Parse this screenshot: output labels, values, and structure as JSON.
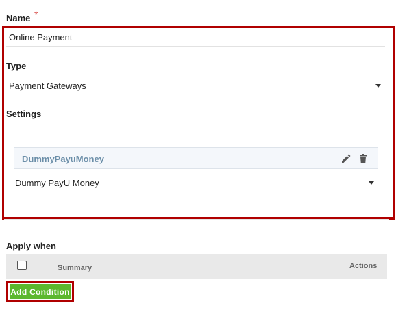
{
  "form": {
    "name_label": "Name",
    "required_mark": "*",
    "name_value": "Online Payment",
    "type_label": "Type",
    "type_value": "Payment Gateways",
    "settings_label": "Settings"
  },
  "gateway": {
    "title": "DummyPayuMoney",
    "select_value": "Dummy PayU Money",
    "edit_icon": "pencil-icon",
    "delete_icon": "trash-icon"
  },
  "apply": {
    "label": "Apply when",
    "columns": {
      "summary": "Summary",
      "actions": "Actions"
    },
    "add_button": "Add Condition"
  },
  "colors": {
    "highlight": "#b00000",
    "add_button": "#5cb82e",
    "gateway_title": "#6b8ea8",
    "required": "#d9534f"
  }
}
